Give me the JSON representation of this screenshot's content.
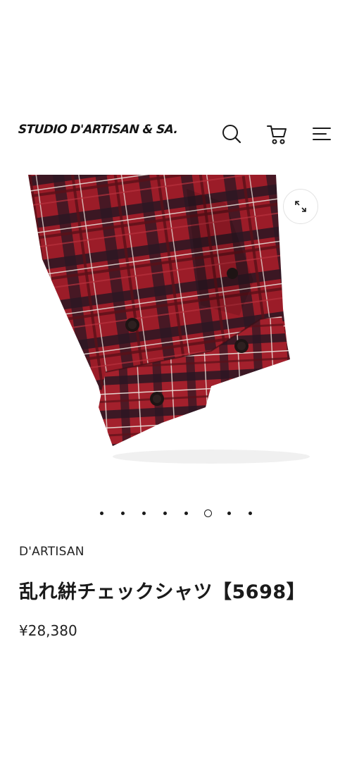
{
  "header": {
    "logo_text": "STUDIO D'ARTISAN & SA.",
    "icons": [
      "search-icon",
      "cart-icon",
      "menu-icon"
    ]
  },
  "gallery": {
    "total_slides": 8,
    "active_index": 5,
    "zoom_icon": "expand-icon"
  },
  "product": {
    "brand": "D'ARTISAN",
    "title": "乱れ絣チェックシャツ【5698】",
    "price": "¥28,380"
  },
  "colors": {
    "fabric_base": "#9b1c28",
    "fabric_dark": "#2a1622",
    "fabric_stripe": "#e9e2dc",
    "accent": "#1a1a1a"
  }
}
